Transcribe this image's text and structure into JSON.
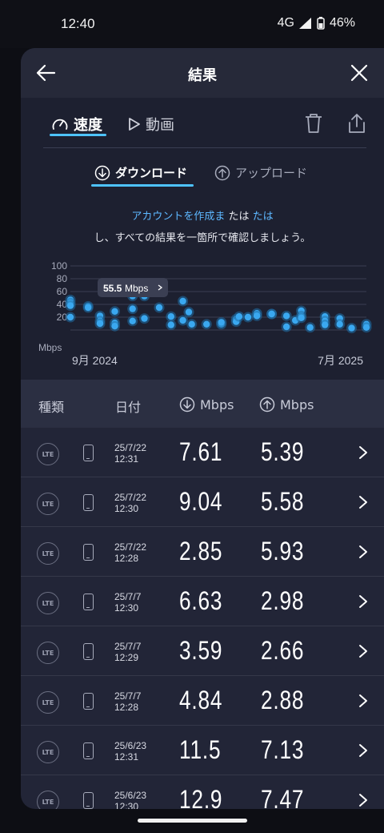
{
  "status": {
    "time": "12:40",
    "network": "4G",
    "battery": "46%"
  },
  "header": {
    "title": "結果"
  },
  "tabs": {
    "speed": "速度",
    "video": "動画"
  },
  "direction_tabs": {
    "download": "ダウンロード",
    "upload": "アップロード"
  },
  "promo": {
    "link1": "アカウントを作成ま",
    "mid": "たは",
    "link2": "たは",
    "line2": "し、すべての結果を一箇所で確認しましょう。"
  },
  "chart_data": {
    "type": "scatter",
    "ylabel": "Mbps",
    "yticks": [
      "100",
      "80",
      "60",
      "40",
      "20"
    ],
    "ylim": [
      0,
      100
    ],
    "x_start_label": "9月 2024",
    "x_end_label": "7月 2025",
    "tooltip": {
      "value": "55.5",
      "unit": "Mbps"
    },
    "points": [
      [
        0.0,
        47
      ],
      [
        0.0,
        42
      ],
      [
        0.0,
        38
      ],
      [
        0.0,
        20
      ],
      [
        0.06,
        37
      ],
      [
        0.06,
        35
      ],
      [
        0.1,
        22
      ],
      [
        0.1,
        14
      ],
      [
        0.1,
        10
      ],
      [
        0.15,
        11
      ],
      [
        0.15,
        6
      ],
      [
        0.15,
        29
      ],
      [
        0.21,
        33
      ],
      [
        0.21,
        53
      ],
      [
        0.21,
        14
      ],
      [
        0.25,
        53
      ],
      [
        0.25,
        18
      ],
      [
        0.3,
        35
      ],
      [
        0.34,
        21
      ],
      [
        0.34,
        8
      ],
      [
        0.38,
        45
      ],
      [
        0.38,
        15
      ],
      [
        0.4,
        28
      ],
      [
        0.41,
        9
      ],
      [
        0.46,
        9
      ],
      [
        0.51,
        9
      ],
      [
        0.51,
        12
      ],
      [
        0.56,
        17
      ],
      [
        0.56,
        13
      ],
      [
        0.57,
        21
      ],
      [
        0.6,
        20
      ],
      [
        0.63,
        26
      ],
      [
        0.63,
        22
      ],
      [
        0.68,
        25
      ],
      [
        0.68,
        25
      ],
      [
        0.73,
        22
      ],
      [
        0.73,
        5
      ],
      [
        0.76,
        15
      ],
      [
        0.78,
        30
      ],
      [
        0.78,
        22
      ],
      [
        0.78,
        19
      ],
      [
        0.81,
        4
      ],
      [
        0.86,
        21
      ],
      [
        0.86,
        14
      ],
      [
        0.86,
        8
      ],
      [
        0.91,
        18
      ],
      [
        0.91,
        9
      ],
      [
        0.95,
        3
      ],
      [
        1.0,
        9
      ],
      [
        1.0,
        4
      ]
    ]
  },
  "table": {
    "col_type": "種類",
    "col_date": "日付",
    "col_down": "Mbps",
    "col_up": "Mbps",
    "rows": [
      {
        "type": "LTE",
        "date": "25/7/22",
        "time": "12:31",
        "down": "7.61",
        "up": "5.39"
      },
      {
        "type": "LTE",
        "date": "25/7/22",
        "time": "12:30",
        "down": "9.04",
        "up": "5.58"
      },
      {
        "type": "LTE",
        "date": "25/7/22",
        "time": "12:28",
        "down": "2.85",
        "up": "5.93"
      },
      {
        "type": "LTE",
        "date": "25/7/7",
        "time": "12:30",
        "down": "6.63",
        "up": "2.98"
      },
      {
        "type": "LTE",
        "date": "25/7/7",
        "time": "12:29",
        "down": "3.59",
        "up": "2.66"
      },
      {
        "type": "LTE",
        "date": "25/7/7",
        "time": "12:28",
        "down": "4.84",
        "up": "2.88"
      },
      {
        "type": "LTE",
        "date": "25/6/23",
        "time": "12:31",
        "down": "11.5",
        "up": "7.13"
      },
      {
        "type": "LTE",
        "date": "25/6/23",
        "time": "12:30",
        "down": "12.9",
        "up": "7.47"
      }
    ]
  },
  "colors": {
    "accent": "#4ec3ff",
    "link": "#5db7ff",
    "sheet": "#222537",
    "point": "#3aa8f0"
  }
}
